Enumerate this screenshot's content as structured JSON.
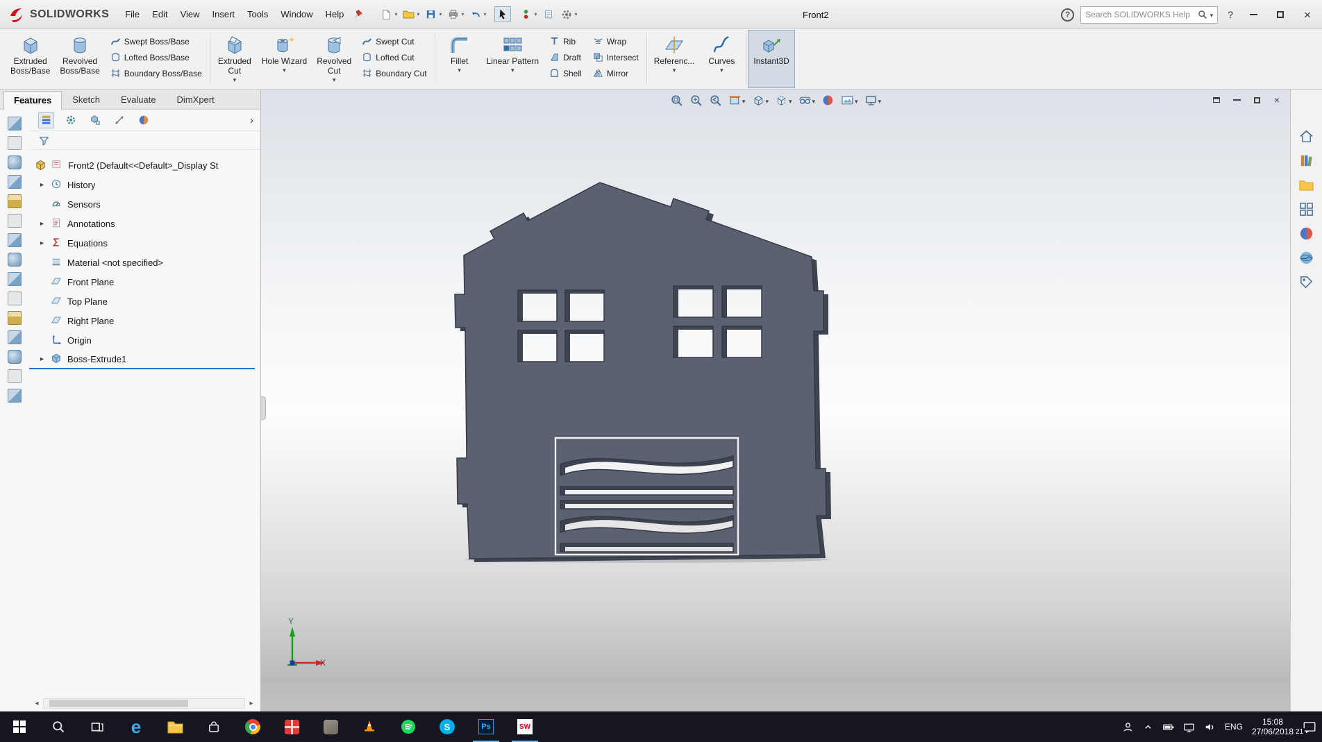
{
  "titlebar": {
    "logo_text": "SOLIDWORKS",
    "menus": [
      "File",
      "Edit",
      "View",
      "Insert",
      "Tools",
      "Window",
      "Help"
    ],
    "document_title": "Front2",
    "search_placeholder": "Search SOLIDWORKS Help",
    "help_symbol": "?"
  },
  "ribbon": {
    "big": [
      {
        "l1": "Extruded",
        "l2": "Boss/Base"
      },
      {
        "l1": "Revolved",
        "l2": "Boss/Base"
      },
      {
        "l1": "Extruded",
        "l2": "Cut"
      },
      {
        "l1": "Hole Wizard",
        "l2": ""
      },
      {
        "l1": "Revolved",
        "l2": "Cut"
      },
      {
        "l1": "Fillet",
        "l2": ""
      },
      {
        "l1": "Linear Pattern",
        "l2": ""
      },
      {
        "l1": "Referenc...",
        "l2": ""
      },
      {
        "l1": "Curves",
        "l2": ""
      },
      {
        "l1": "Instant3D",
        "l2": ""
      }
    ],
    "small": [
      [
        "Swept Boss/Base",
        "Lofted Boss/Base",
        "Boundary Boss/Base"
      ],
      [
        "Swept Cut",
        "Lofted Cut",
        "Boundary Cut"
      ],
      [
        "Rib",
        "Draft",
        "Shell"
      ],
      [
        "Wrap",
        "Intersect",
        "Mirror"
      ]
    ]
  },
  "tabs": [
    "Features",
    "Sketch",
    "Evaluate",
    "DimXpert"
  ],
  "tree": {
    "root_label": "Front2 (Default<<Default>_Display St",
    "items": [
      "History",
      "Sensors",
      "Annotations",
      "Equations",
      "Material <not specified>",
      "Front Plane",
      "Top Plane",
      "Right Plane",
      "Origin",
      "Boss-Extrude1"
    ]
  },
  "viewport": {
    "triad_x": "X",
    "triad_y": "Y"
  },
  "icons": {
    "hud": [
      "zoom-fit",
      "zoom-area",
      "previous-view",
      "section-view",
      "view-orientation",
      "display-style",
      "hide-show-items",
      "edit-appearance",
      "apply-scene",
      "view-settings"
    ],
    "task_pane": [
      "home",
      "design-library",
      "file-explorer",
      "view-palette",
      "appearances",
      "scenes",
      "custom-properties"
    ],
    "taskbar": [
      "windows-start",
      "search",
      "task-view",
      "edge-browser",
      "file-explorer",
      "store",
      "chrome",
      "gift-app",
      "utility-app",
      "vlc",
      "spotify",
      "skype",
      "photoshop",
      "solidworks"
    ],
    "tray": [
      "people",
      "hidden-icons-chevron",
      "battery",
      "display",
      "volume"
    ]
  },
  "taskbar": {
    "lang": "ENG",
    "time": "15:08",
    "date": "27/06/2018",
    "badge": "21"
  },
  "colors": {
    "model_gray": "#5b6170",
    "selection_blue": "#2a6fd4",
    "taskbar_bg": "#161620"
  }
}
